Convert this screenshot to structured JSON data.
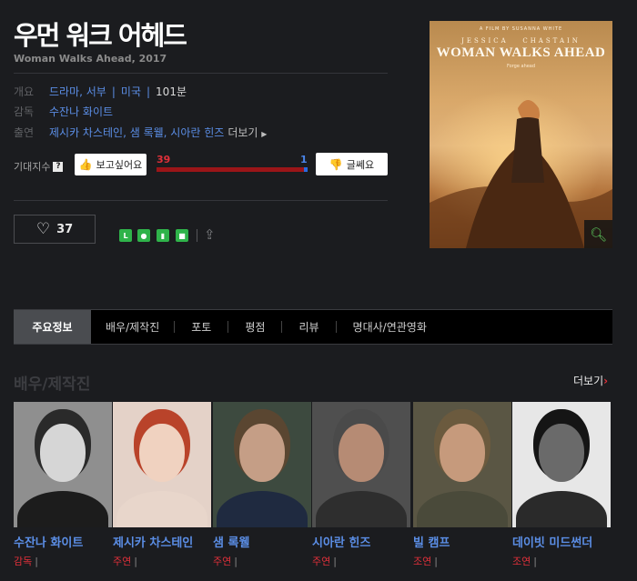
{
  "movie": {
    "title_ko": "우먼 워크 어헤드",
    "title_en": "Woman Walks Ahead, 2017"
  },
  "info": {
    "overview_key": "개요",
    "genres": [
      "드라마",
      "서부"
    ],
    "country": "미국",
    "runtime": "101분",
    "director_key": "감독",
    "director": "수잔나 화이트",
    "cast_key": "출연",
    "cast_line": "제시카 차스테인, 샘 록웰, 시아란 힌즈",
    "more": "더보기"
  },
  "expectation": {
    "label": "기대지수",
    "help": "?",
    "want_label": "보고싶어요",
    "notsure_label": "글쎄요",
    "want_count": 39,
    "notsure_count": 1,
    "colors": {
      "want": "#9b1518",
      "notsure": "#2b6be0"
    }
  },
  "likes": {
    "count": "37"
  },
  "share_icons": [
    "line-icon",
    "kakaostory-icon",
    "bookmark-icon",
    "band-icon",
    "share-out-icon"
  ],
  "poster": {
    "small_text": "A FILM BY SUSANNA WHITE",
    "actor_text": "JESSICA   CHASTAIN",
    "title_text": "WOMAN WALKS AHEAD",
    "tagline": "Forge ahead"
  },
  "tabs": [
    "주요정보",
    "배우/제작진",
    "포토",
    "평점",
    "리뷰",
    "명대사/연관영화"
  ],
  "cast_section": {
    "heading": "배우/제작진",
    "more": "더보기"
  },
  "cast": [
    {
      "name": "수잔나 화이트",
      "role": "감독",
      "bg": "#8f8f8f",
      "face": "#d6d6d6",
      "hair": "#2a2a2a",
      "cloth": "#1c1c1c"
    },
    {
      "name": "제시카 차스테인",
      "role": "주연",
      "bg": "#e4d2c8",
      "face": "#f0d2c0",
      "hair": "#b9432a",
      "cloth": "#e8d6cb"
    },
    {
      "name": "샘 록웰",
      "role": "주연",
      "bg": "#3d4a3f",
      "face": "#c59e86",
      "hair": "#5a4631",
      "cloth": "#1f2a40"
    },
    {
      "name": "시아란 힌즈",
      "role": "주연",
      "bg": "#4f4f4f",
      "face": "#b68b74",
      "hair": "#4a4a4a",
      "cloth": "#2e2e2e"
    },
    {
      "name": "빌 캠프",
      "role": "조연",
      "bg": "#5a5644",
      "face": "#c69a7c",
      "hair": "#6b5a3e",
      "cloth": "#4a4a3a"
    },
    {
      "name": "데이빗 미드썬더",
      "role": "조연",
      "bg": "#e7e7e7",
      "face": "#6a6a6a",
      "hair": "#151515",
      "cloth": "#2a2a2a"
    }
  ]
}
